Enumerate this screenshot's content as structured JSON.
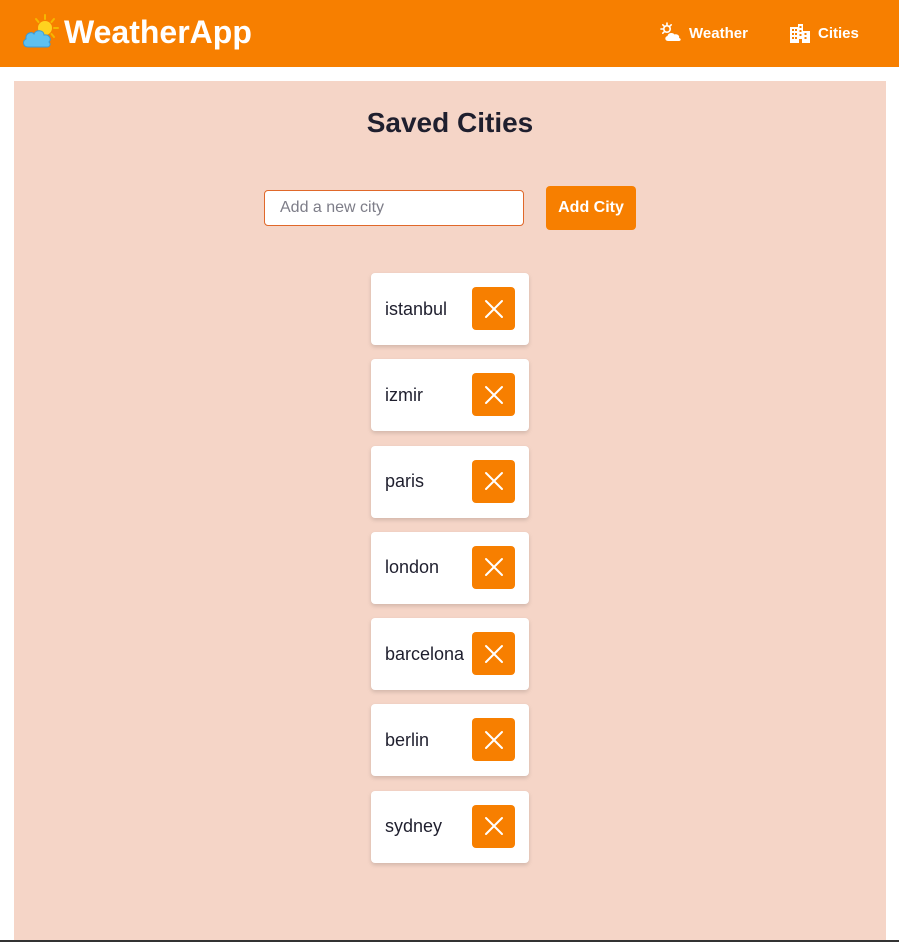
{
  "header": {
    "title": "WeatherApp",
    "brand_icon": "sun-behind-cloud-icon",
    "nav": [
      {
        "label": "Weather",
        "icon": "sun-cloud-icon"
      },
      {
        "label": "Cities",
        "icon": "city-buildings-icon"
      }
    ]
  },
  "main": {
    "title": "Saved Cities",
    "input_placeholder": "Add a new city",
    "input_value": "",
    "add_button_label": "Add City",
    "cities": [
      {
        "name": "istanbul"
      },
      {
        "name": "izmir"
      },
      {
        "name": "paris"
      },
      {
        "name": "london"
      },
      {
        "name": "barcelona"
      },
      {
        "name": "berlin"
      },
      {
        "name": "sydney"
      }
    ],
    "remove_icon": "close-icon"
  },
  "colors": {
    "accent": "#f77f00",
    "panel_bg": "#f5d5c7",
    "text_dark": "#1f1f2e"
  }
}
